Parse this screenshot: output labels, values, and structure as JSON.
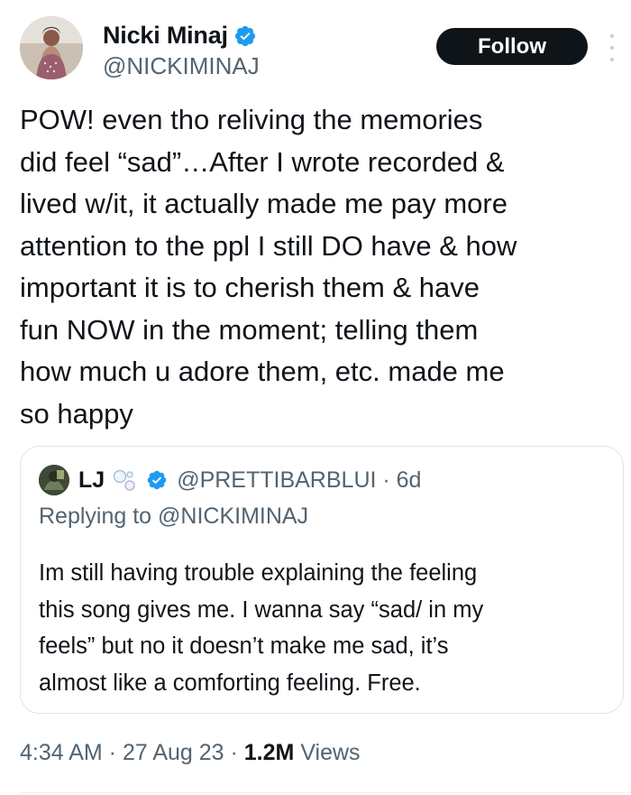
{
  "author": {
    "display_name": "Nicki Minaj",
    "handle": "@NICKIMINAJ",
    "verified": true,
    "avatar_icon": "profile-photo"
  },
  "follow_label": "Follow",
  "more_icon": "vertical-ellipsis-icon",
  "tweet": {
    "lines": [
      "POW! even tho reliving the memories",
      "did feel “sad”…After I wrote recorded &",
      "lived w/it, it actually made me pay more",
      "attention to the ppl I still DO have & how",
      "important it is to cherish them & have",
      "fun NOW in the moment; telling them",
      "how much u adore them, etc. made me",
      "so happy"
    ]
  },
  "quoted": {
    "display_name": "LJ",
    "emoji_icon": "bubbles-icon",
    "verified": true,
    "handle_time": "@PRETTIBARBLUI · 6d",
    "replying_to": "Replying to @NICKIMINAJ",
    "lines": [
      "Im still having trouble explaining the feeling",
      "this song gives me.  I wanna say “sad/ in my",
      "feels” but no it doesn’t make me sad, it’s",
      "almost like a comforting feeling. Free."
    ]
  },
  "meta": {
    "time_date": "4:34 AM · 27 Aug 23 · ",
    "views_count": "1.2M",
    "views_label": " Views"
  },
  "colors": {
    "text": "#0f1419",
    "secondary": "#536471",
    "verified": "#1d9bf0",
    "border": "#dde3e7"
  }
}
